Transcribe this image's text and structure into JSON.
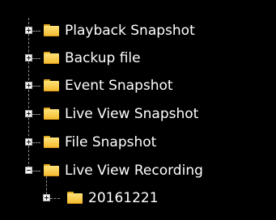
{
  "tree": {
    "items": [
      {
        "label": "Playback Snapshot",
        "state": "collapsed",
        "icon": "folder-icon"
      },
      {
        "label": "Backup file",
        "state": "collapsed",
        "icon": "folder-icon"
      },
      {
        "label": "Event Snapshot",
        "state": "collapsed",
        "icon": "folder-icon"
      },
      {
        "label": "Live View Snapshot",
        "state": "collapsed",
        "icon": "folder-icon"
      },
      {
        "label": "File Snapshot",
        "state": "collapsed",
        "icon": "folder-icon"
      },
      {
        "label": "Live View Recording",
        "state": "expanded",
        "icon": "folder-icon",
        "children": [
          {
            "label": "20161221",
            "state": "collapsed",
            "icon": "folder-icon"
          }
        ]
      }
    ]
  },
  "colors": {
    "background": "#000000",
    "text": "#ffffff",
    "folder": "#f3b92c",
    "connector": "#8a8a8a"
  }
}
